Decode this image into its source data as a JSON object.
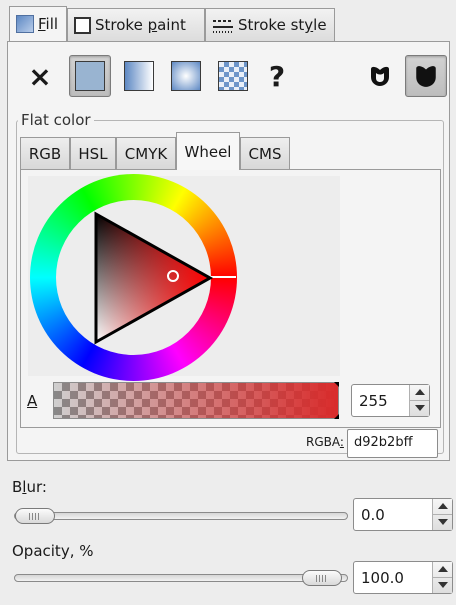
{
  "tabs": [
    {
      "label_pre": "",
      "label_ul": "F",
      "label_post": "ill",
      "icon": "fill-icon"
    },
    {
      "label_pre": "Stroke ",
      "label_ul": "p",
      "label_post": "aint",
      "icon": "stroke-paint-icon"
    },
    {
      "label_pre": "Stroke st",
      "label_ul": "y",
      "label_post": "le",
      "icon": "stroke-style-icon"
    }
  ],
  "paint_modes": {
    "no_paint": "×",
    "unset": "?"
  },
  "flat_color_label": "Flat color",
  "color_tabs": [
    "RGB",
    "HSL",
    "CMYK",
    "Wheel",
    "CMS"
  ],
  "active_color_tab": "Wheel",
  "alpha": {
    "label": "A",
    "value": "255"
  },
  "rgba": {
    "label_pre": "RGBA",
    "label_ul": ":",
    "value": "d92b2bff"
  },
  "blur": {
    "label_pre": "B",
    "label_ul": "l",
    "label_post": "ur:",
    "value": "0.0",
    "fraction": 0.0
  },
  "opacity": {
    "label": "Opacity, %",
    "value": "100.0",
    "fraction": 1.0
  },
  "colors": {
    "current": "#d92b2b",
    "swatch_flat": "#99b4d1"
  }
}
